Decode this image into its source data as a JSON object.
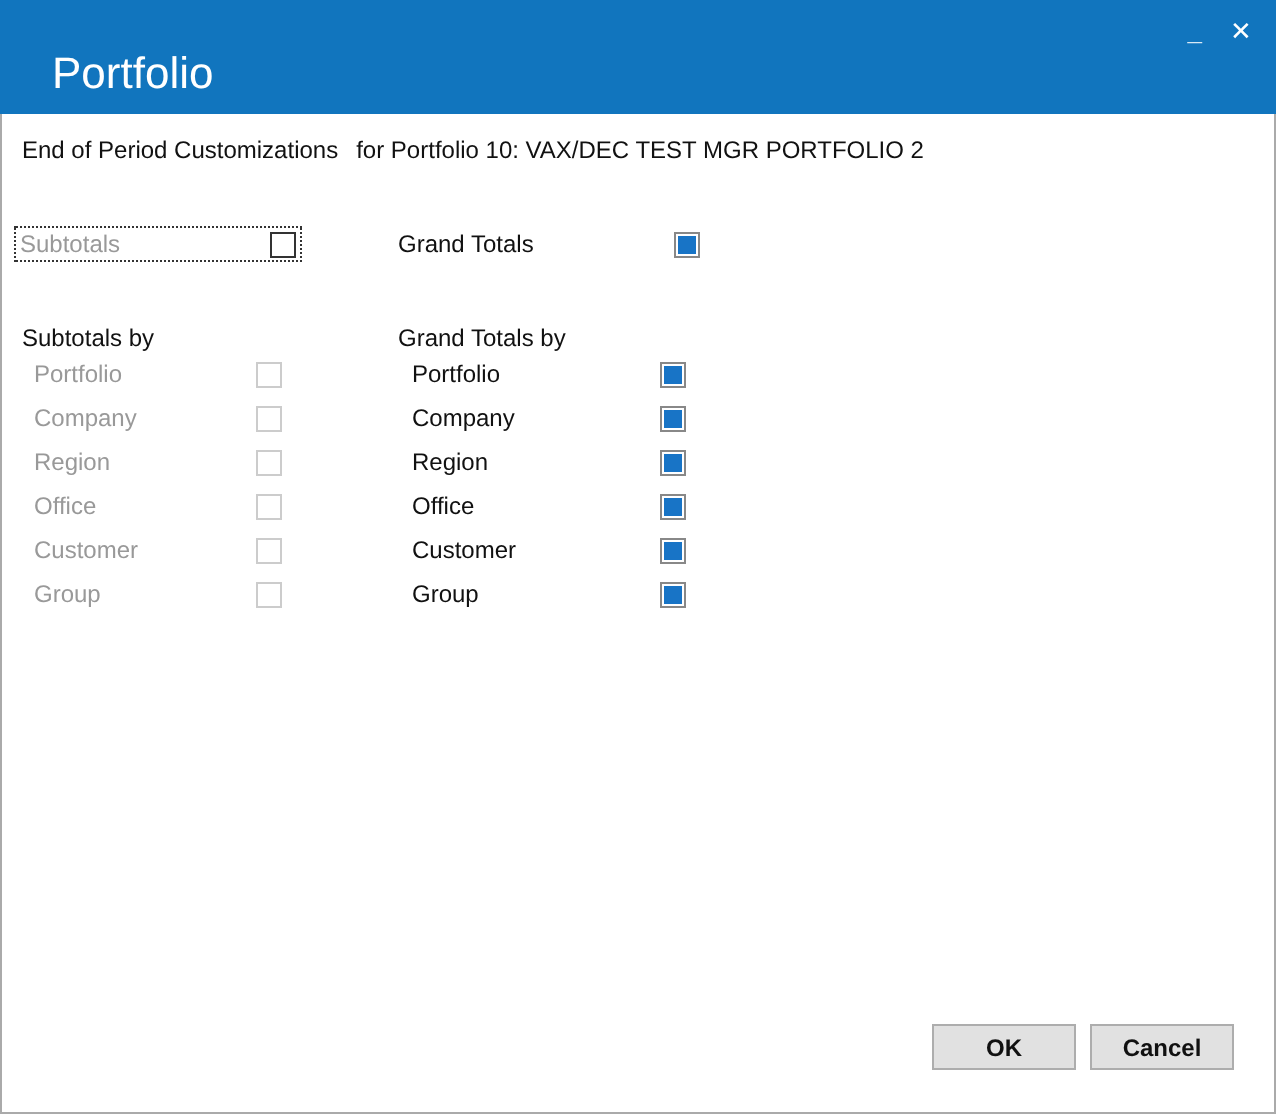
{
  "window": {
    "title": "Portfolio",
    "controls": [
      "_",
      "✕"
    ]
  },
  "heading": {
    "label": "End of Period Customizations",
    "value": "for Portfolio 10: VAX/DEC TEST MGR PORTFOLIO 2"
  },
  "subtotals": {
    "label": "Subtotals",
    "checked": false,
    "focused": true
  },
  "grand_totals": {
    "label": "Grand Totals",
    "checked": true
  },
  "subtotals_by": {
    "title": "Subtotals by",
    "items": [
      {
        "label": "Portfolio",
        "checked": false,
        "disabled": true
      },
      {
        "label": "Company",
        "checked": false,
        "disabled": true
      },
      {
        "label": "Region",
        "checked": false,
        "disabled": true
      },
      {
        "label": "Office",
        "checked": false,
        "disabled": true
      },
      {
        "label": "Customer",
        "checked": false,
        "disabled": true
      },
      {
        "label": "Group",
        "checked": false,
        "disabled": true
      }
    ]
  },
  "grand_totals_by": {
    "title": "Grand Totals by",
    "items": [
      {
        "label": "Portfolio",
        "checked": true,
        "disabled": false
      },
      {
        "label": "Company",
        "checked": true,
        "disabled": false
      },
      {
        "label": "Region",
        "checked": true,
        "disabled": false
      },
      {
        "label": "Office",
        "checked": true,
        "disabled": false
      },
      {
        "label": "Customer",
        "checked": true,
        "disabled": false
      },
      {
        "label": "Group",
        "checked": true,
        "disabled": false
      }
    ]
  },
  "buttons": [
    "OK",
    "Cancel"
  ]
}
